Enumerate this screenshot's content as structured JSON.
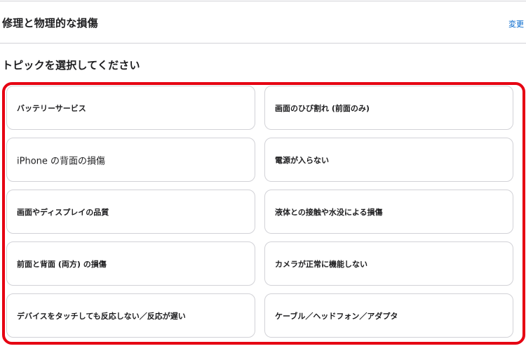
{
  "section": {
    "title": "修理と物理的な損傷",
    "change_link": "変更"
  },
  "prompt": {
    "heading": "トピックを選択してください"
  },
  "topics": [
    {
      "label": "バッテリーサービス"
    },
    {
      "label": "画面のひび割れ (前面のみ)"
    },
    {
      "label": "iPhone の背面の損傷"
    },
    {
      "label": "電源が入らない"
    },
    {
      "label": "画面やディスプレイの品質"
    },
    {
      "label": "液体との接触や水没による損傷"
    },
    {
      "label": "前面と背面 (両方) の損傷"
    },
    {
      "label": "カメラが正常に機能しない"
    },
    {
      "label": "デバイスをタッチしても反応しない／反応が遅い"
    },
    {
      "label": "ケーブル／ヘッドフォン／アダプタ"
    }
  ],
  "colors": {
    "highlight": "#e60012",
    "link": "#0066cc",
    "card_border": "#d2d2d7"
  }
}
